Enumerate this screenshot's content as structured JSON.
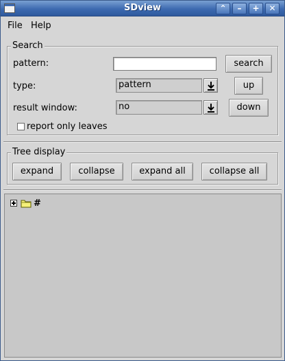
{
  "window": {
    "title": "SDview"
  },
  "titlebar_buttons": {
    "shade": "⌃",
    "minimize": "–",
    "maximize": "+",
    "close": "✕"
  },
  "menu": {
    "file": "File",
    "help": "Help"
  },
  "search": {
    "title": "Search",
    "pattern_label": "pattern:",
    "pattern_value": "",
    "search_button": "search",
    "type_label": "type:",
    "type_value": "pattern",
    "up_button": "up",
    "result_window_label": "result window:",
    "result_window_value": "no",
    "down_button": "down",
    "report_only_leaves_label": "report only leaves",
    "report_only_leaves_checked": false
  },
  "tree_display": {
    "title": "Tree display",
    "expand": "expand",
    "collapse": "collapse",
    "expand_all": "expand all",
    "collapse_all": "collapse all"
  },
  "tree": {
    "root_label": "#",
    "root_icon": "folder-icon",
    "expander_icon": "plus-box-icon"
  },
  "colors": {
    "titlebar": "#3d6ab0",
    "window_bg": "#d6d6d6",
    "tree_bg": "#c8c8c8",
    "folder": "#f5f07a"
  }
}
